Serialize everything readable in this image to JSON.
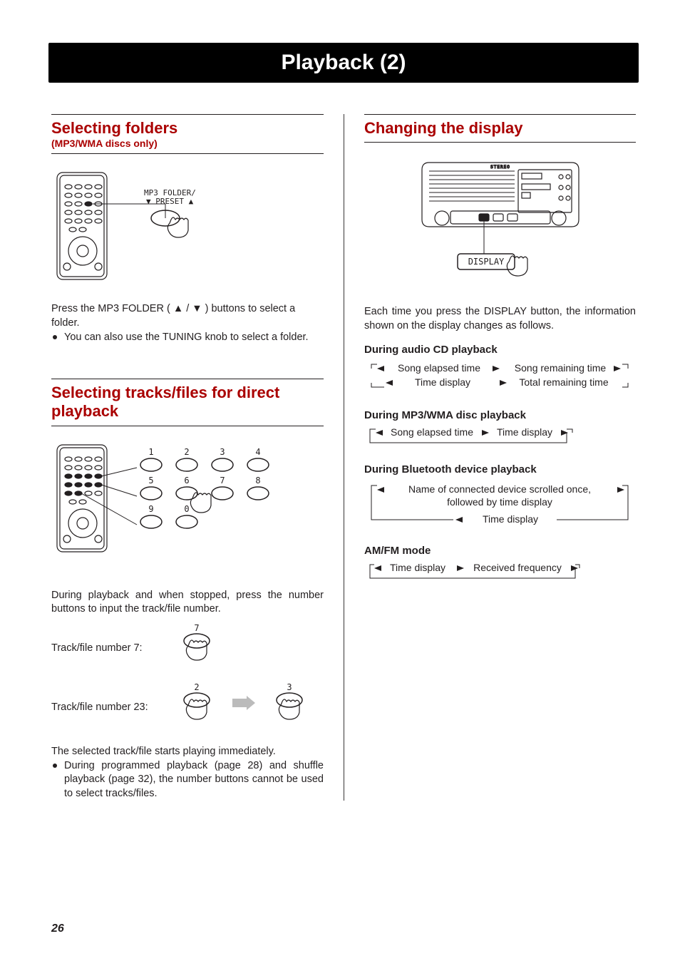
{
  "page": {
    "title": "Playback (2)",
    "number": "26"
  },
  "left": {
    "selecting_folders": {
      "heading": "Selecting folders",
      "sub": "(MP3/WMA discs only)",
      "fig_label": "MP3 FOLDER/\n▼ PRESET ▲",
      "body": "Press the MP3 FOLDER ( ▲ / ▼ ) buttons to select a folder.",
      "bullet1": "You can also use the TUNING knob to select a folder."
    },
    "direct_playback": {
      "heading": "Selecting tracks/files for direct playback",
      "numpad": {
        "row1": [
          "1",
          "2",
          "3",
          "4"
        ],
        "row2": [
          "5",
          "6",
          "7",
          "8"
        ],
        "row3": [
          "9",
          "0"
        ]
      },
      "body": "During playback and when stopped, press the number buttons to input the track/file number.",
      "example7": {
        "label": "Track/file number 7:",
        "digit": "7"
      },
      "example23": {
        "label": "Track/file number 23:",
        "digits": [
          "2",
          "3"
        ]
      },
      "after": "The selected track/file starts playing immediately.",
      "bullet1": "During programmed playback (page 28) and shuffle playback (page 32), the number buttons cannot be used to select tracks/files."
    }
  },
  "right": {
    "heading": "Changing the display",
    "fig_label": "DISPLAY",
    "fig_text": {
      "stereo": "STEREO"
    },
    "body": "Each time you press the DISPLAY button, the information shown on the display changes as follows.",
    "audio_cd": {
      "heading": "During audio CD playback",
      "items": {
        "a": "Song elapsed time",
        "b": "Song remaining time",
        "c": "Time display",
        "d": "Total remaining time"
      }
    },
    "mp3": {
      "heading": "During MP3/WMA disc playback",
      "items": {
        "a": "Song elapsed time",
        "b": "Time display"
      }
    },
    "bt": {
      "heading": "During Bluetooth device playback",
      "items": {
        "a": "Name of connected device scrolled once, followed by time display",
        "b": "Time display"
      }
    },
    "amfm": {
      "heading": "AM/FM mode",
      "items": {
        "a": "Time display",
        "b": "Received frequency"
      }
    }
  }
}
